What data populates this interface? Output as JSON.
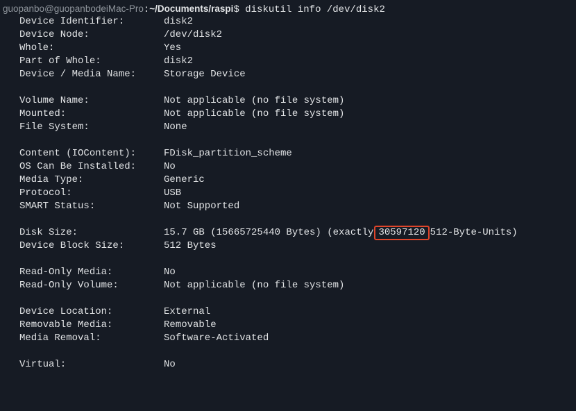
{
  "terminal": {
    "prompt": {
      "user_host": "guopanbo@guopanbodeiMac-Pro",
      "separator": ":",
      "path": "~/Documents/raspi",
      "symbol": "$",
      "command": "diskutil info /dev/disk2"
    },
    "rows": [
      {
        "key": "Device Identifier:",
        "value": "disk2"
      },
      {
        "key": "Device Node:",
        "value": "/dev/disk2"
      },
      {
        "key": "Whole:",
        "value": "Yes"
      },
      {
        "key": "Part of Whole:",
        "value": "disk2"
      },
      {
        "key": "Device / Media Name:",
        "value": "Storage Device"
      },
      {
        "key": "Volume Name:",
        "value": "Not applicable (no file system)"
      },
      {
        "key": "Mounted:",
        "value": "Not applicable (no file system)"
      },
      {
        "key": "File System:",
        "value": "None"
      },
      {
        "key": "Content (IOContent):",
        "value": "FDisk_partition_scheme"
      },
      {
        "key": "OS Can Be Installed:",
        "value": "No"
      },
      {
        "key": "Media Type:",
        "value": "Generic"
      },
      {
        "key": "Protocol:",
        "value": "USB"
      },
      {
        "key": "SMART Status:",
        "value": "Not Supported"
      },
      {
        "key": "Disk Size:",
        "value_prefix": "15.7 GB (15665725440 Bytes) (exactly",
        "value_highlight": "30597120",
        "value_suffix": "512-Byte-Units)"
      },
      {
        "key": "Device Block Size:",
        "value": "512 Bytes"
      },
      {
        "key": "Read-Only Media:",
        "value": "No"
      },
      {
        "key": "Read-Only Volume:",
        "value": "Not applicable (no file system)"
      },
      {
        "key": "Device Location:",
        "value": "External"
      },
      {
        "key": "Removable Media:",
        "value": "Removable"
      },
      {
        "key": "Media Removal:",
        "value": "Software-Activated"
      },
      {
        "key": "Virtual:",
        "value": "No"
      }
    ],
    "highlight_color": "#e0452a",
    "background_color": "#161b24",
    "text_color": "#e2e4e6"
  }
}
